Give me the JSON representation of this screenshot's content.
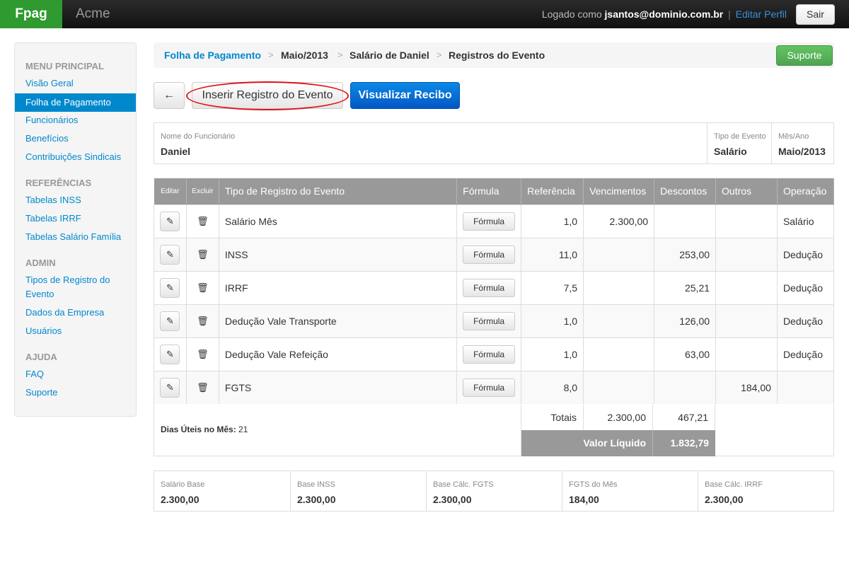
{
  "topbar": {
    "brand": "Fpag",
    "company": "Acme",
    "logged_prefix": "Logado como",
    "user": "jsantos@dominio.com.br",
    "separator": "|",
    "edit_profile": "Editar Perfil",
    "logout": "Sair"
  },
  "sidebar": {
    "sections": [
      {
        "title": "MENU PRINCIPAL",
        "items": [
          "Visão Geral",
          "Folha de Pagamento",
          "Funcionários",
          "Benefícios",
          "Contribuições Sindicais"
        ]
      },
      {
        "title": "REFERÊNCIAS",
        "items": [
          "Tabelas INSS",
          "Tabelas IRRF",
          "Tabelas Salário Família"
        ]
      },
      {
        "title": "ADMIN",
        "items": [
          "Tipos de Registro do",
          "Evento",
          "Dados da Empresa",
          "Usuários"
        ]
      },
      {
        "title": "AJUDA",
        "items": [
          "FAQ",
          "Suporte"
        ]
      }
    ],
    "active": "Folha de Pagamento"
  },
  "breadcrumb": {
    "items": [
      "Folha de Pagamento",
      "Maio/2013",
      "Salário de Daniel",
      "Registros do Evento"
    ],
    "sep": ">",
    "support": "Suporte"
  },
  "toolbar": {
    "back_icon": "←",
    "insert": "Inserir Registro do Evento",
    "view_receipt": "Visualizar Recibo"
  },
  "info": {
    "employee_label": "Nome do Funcionário",
    "employee": "Daniel",
    "event_type_label": "Tipo de Evento",
    "event_type": "Salário",
    "month_label": "Mês/Ano",
    "month": "Maio/2013"
  },
  "table": {
    "headers": [
      "Editar",
      "Excluir",
      "Tipo de Registro do Evento",
      "Fórmula",
      "Referência",
      "Vencimentos",
      "Descontos",
      "Outros",
      "Operação"
    ],
    "formula_label": "Fórmula",
    "rows": [
      {
        "tipo": "Salário Mês",
        "ref": "1,0",
        "venc": "2.300,00",
        "desc": "",
        "outros": "",
        "op": "Salário"
      },
      {
        "tipo": "INSS",
        "ref": "11,0",
        "venc": "",
        "desc": "253,00",
        "outros": "",
        "op": "Dedução"
      },
      {
        "tipo": "IRRF",
        "ref": "7,5",
        "venc": "",
        "desc": "25,21",
        "outros": "",
        "op": "Dedução"
      },
      {
        "tipo": "Dedução Vale Transporte",
        "ref": "1,0",
        "venc": "",
        "desc": "126,00",
        "outros": "",
        "op": "Dedução"
      },
      {
        "tipo": "Dedução Vale Refeição",
        "ref": "1,0",
        "venc": "",
        "desc": "63,00",
        "outros": "",
        "op": "Dedução"
      },
      {
        "tipo": "FGTS",
        "ref": "8,0",
        "venc": "",
        "desc": "",
        "outros": "184,00",
        "op": ""
      }
    ]
  },
  "totals": {
    "dias_label": "Dias Úteis no Mês:",
    "dias": "21",
    "totais_label": "Totais",
    "venc": "2.300,00",
    "desc": "467,21",
    "liquido_label": "Valor Líquido",
    "liquido": "1.832,79"
  },
  "summary": [
    {
      "label": "Salário Base",
      "value": "2.300,00"
    },
    {
      "label": "Base INSS",
      "value": "2.300,00"
    },
    {
      "label": "Base Cálc. FGTS",
      "value": "2.300,00"
    },
    {
      "label": "FGTS do Mês",
      "value": "184,00"
    },
    {
      "label": "Base Cálc. IRRF",
      "value": "2.300,00"
    }
  ],
  "colors": {
    "brand": "#2f9a2f",
    "link": "#0088cc",
    "primary": "#0456c4",
    "success": "#51a351",
    "highlight": "#e0121a"
  }
}
